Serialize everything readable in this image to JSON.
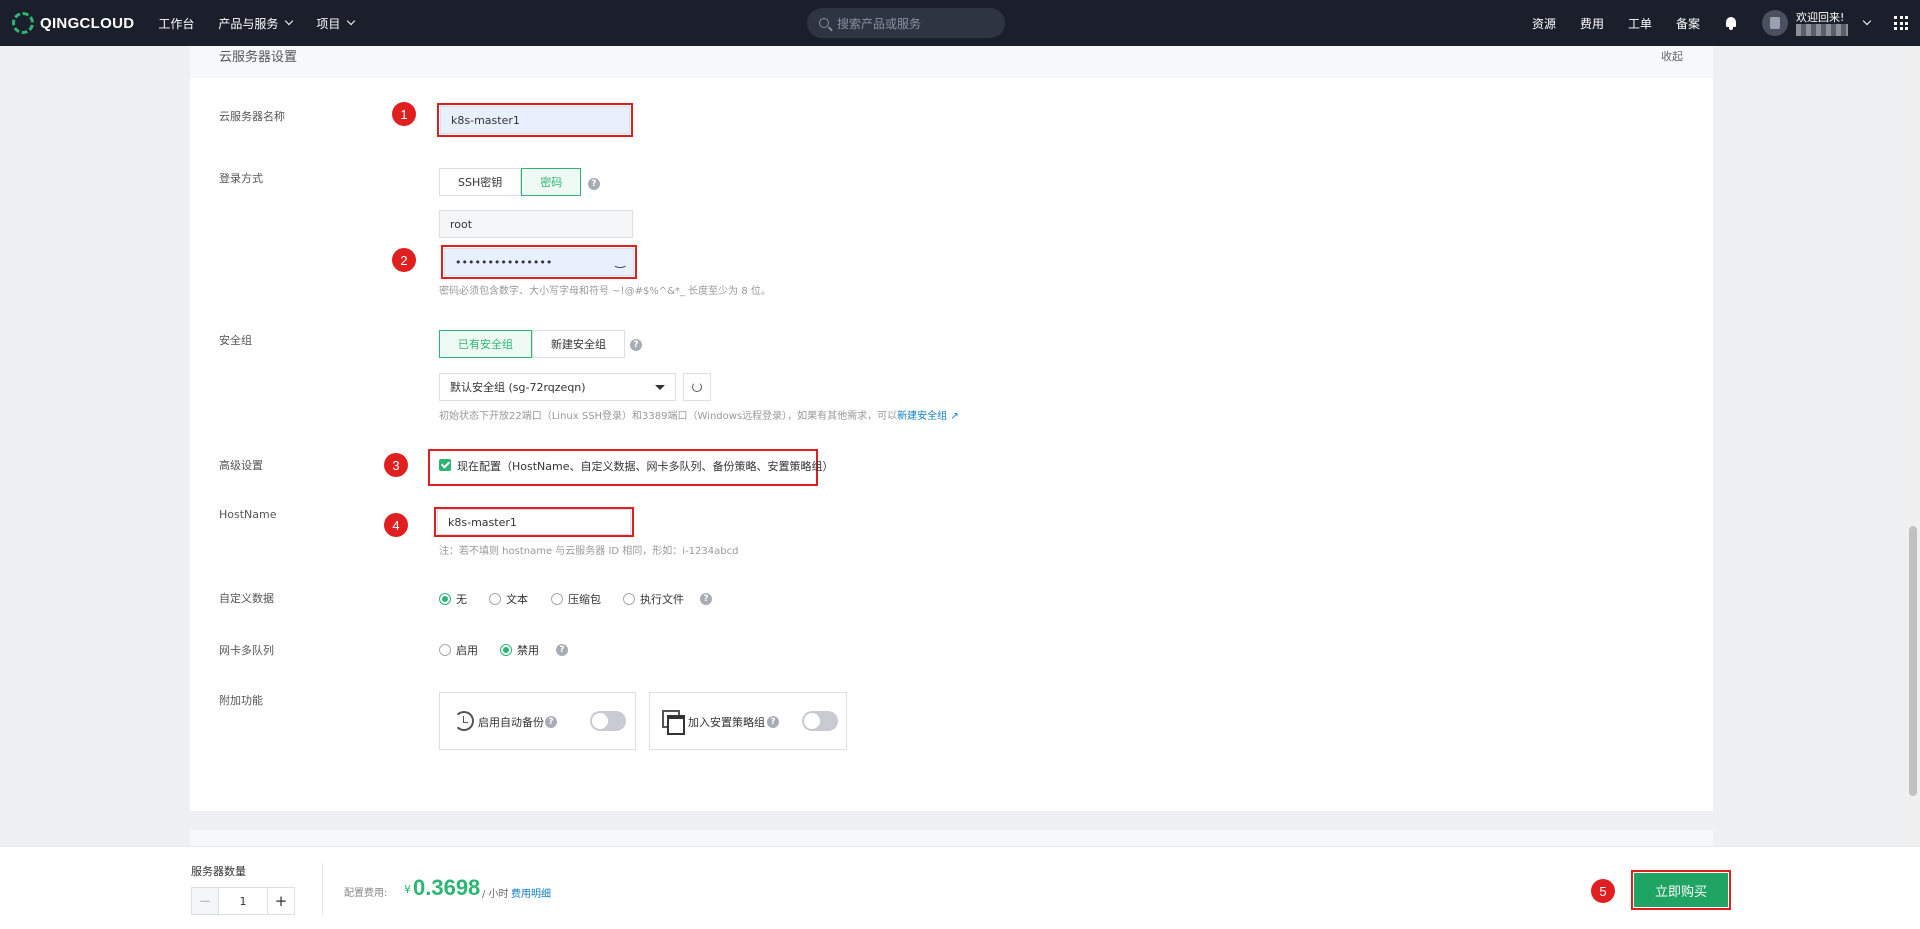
{
  "nav": {
    "brand": "QINGCLOUD",
    "workbench": "工作台",
    "products": "产品与服务",
    "projects": "项目",
    "search_placeholder": "搜索产品或服务",
    "resources": "资源",
    "billing": "费用",
    "tickets": "工单",
    "icp": "备案",
    "welcome": "欢迎回来!"
  },
  "section": {
    "title": "云服务器设置",
    "collapse": "收起"
  },
  "form": {
    "name_label": "云服务器名称",
    "name_value": "k8s-master1",
    "login_label": "登录方式",
    "login_options": [
      "SSH密钥",
      "密码"
    ],
    "username_value": "root",
    "password_value": "•••••••••••••••",
    "password_hint": "密码必须包含数字、大小写字母和符号 ~!@#$%^&*_ 长度至少为 8 位。",
    "sg_label": "安全组",
    "sg_options": [
      "已有安全组",
      "新建安全组"
    ],
    "sg_selected": "默认安全组 (sg-72rqzeqn)",
    "sg_hint": "初始状态下开放22端口（Linux SSH登录）和3389端口（Windows远程登录），如果有其他需求，可以",
    "sg_hint_link": "新建安全组",
    "advanced_label": "高级设置",
    "advanced_check": "现在配置（HostName、自定义数据、网卡多队列、备份策略、安置策略组）",
    "hostname_label": "HostName",
    "hostname_value": "k8s-master1",
    "hostname_hint": "注：若不填则 hostname 与云服务器 ID 相同，形如：i-1234abcd",
    "userdata_label": "自定义数据",
    "userdata_options": [
      "无",
      "文本",
      "压缩包",
      "执行文件"
    ],
    "nic_label": "网卡多队列",
    "nic_options": [
      "启用",
      "禁用"
    ],
    "addon_label": "附加功能",
    "addon_backup": "启用自动备份",
    "addon_group": "加入安置策略组"
  },
  "markers": [
    "1",
    "2",
    "3",
    "4",
    "5"
  ],
  "footer": {
    "qty_label": "服务器数量",
    "qty_minus": "−",
    "qty_value": "1",
    "qty_plus": "+",
    "fee_label": "配置费用:",
    "currency": "¥",
    "price": "0.3698",
    "unit": "/ 小时",
    "fee_detail": "费用明细",
    "buy": "立即购买"
  },
  "colors": {
    "brand_green": "#2bb673",
    "buy_green": "#1fa463",
    "annotation_red": "#e02020",
    "nav_bg": "#1a1f2b"
  }
}
